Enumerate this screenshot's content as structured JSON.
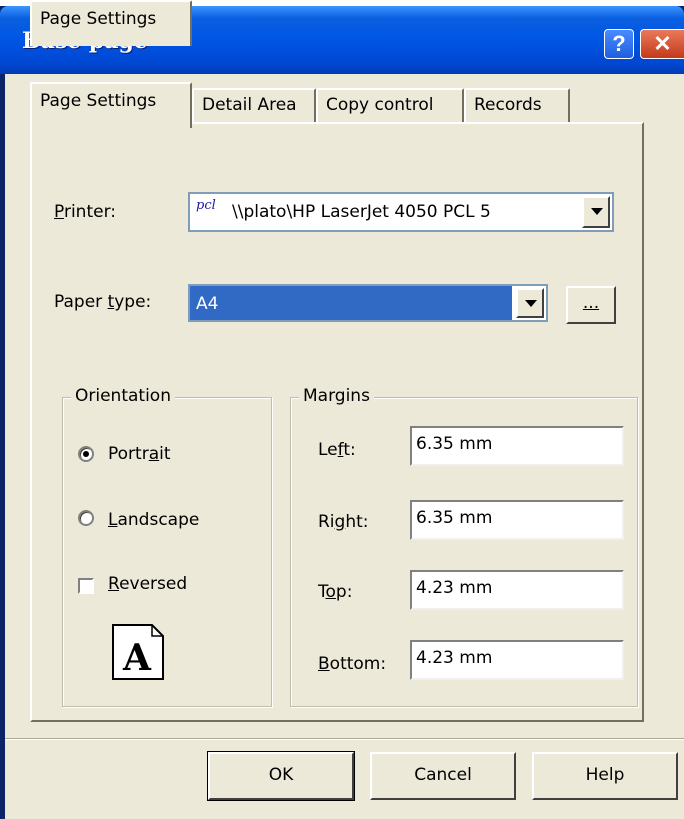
{
  "window": {
    "title": "Base page"
  },
  "tabs": [
    {
      "label": "Page Settings",
      "active": true
    },
    {
      "label": "Detail Area",
      "active": false
    },
    {
      "label": "Copy control",
      "active": false
    },
    {
      "label": "Records",
      "active": false
    }
  ],
  "printer": {
    "label_prefix": "P",
    "label_rest": "rinter:",
    "badge": "pcl",
    "value": "\\\\plato\\HP LaserJet 4050 PCL 5"
  },
  "paper_type": {
    "label_prefix": "Paper ",
    "label_ul": "t",
    "label_rest": "ype:",
    "value": "A4",
    "ellipsis": "..."
  },
  "orientation": {
    "title": "Orientation",
    "portrait": {
      "pre": "Portr",
      "ul": "a",
      "post": "it",
      "checked": true
    },
    "landscape": {
      "pre": "",
      "ul": "L",
      "post": "andscape",
      "checked": false
    },
    "reversed": {
      "pre": "",
      "ul": "R",
      "post": "eversed",
      "checked": false
    },
    "page_glyph": "A"
  },
  "margins": {
    "title": "Margins",
    "left": {
      "pre": "Le",
      "ul": "f",
      "post": "t:",
      "value": "6.35 mm"
    },
    "right": {
      "pre": "Ri",
      "ul": "g",
      "post": "ht:",
      "value": "6.35 mm"
    },
    "top": {
      "pre": "T",
      "ul": "o",
      "post": "p:",
      "value": "4.23 mm"
    },
    "bottom": {
      "pre": "",
      "ul": "B",
      "post": "ottom:",
      "value": "4.23 mm"
    }
  },
  "buttons": {
    "ok": "OK",
    "cancel": "Cancel",
    "help": "Help"
  },
  "colors": {
    "title_bar": "#0055e5",
    "dialog_face": "#ece9d8",
    "selection": "#316ac5",
    "close_button": "#c3391a"
  }
}
